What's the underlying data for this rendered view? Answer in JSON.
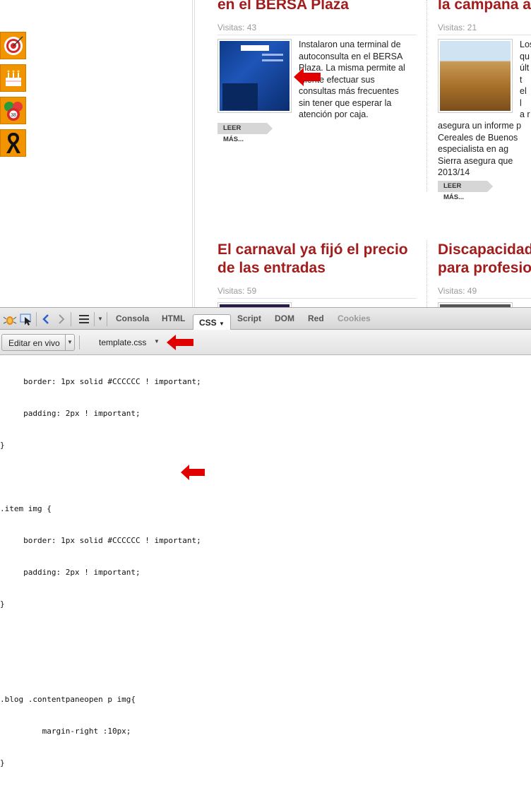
{
  "articles": [
    {
      "title_line2": "en el BERSA Plaza",
      "visits": "Visitas: 43",
      "text_lines": [
        "Instalaron una terminal de",
        "autoconsulta en el BERSA",
        "Plaza. La misma permite al",
        "cliente efectuar sus",
        "consultas más frecuentes",
        "sin tener que esperar la",
        "atención por caja."
      ],
      "read_more": "LEER MÁS..."
    },
    {
      "title_line2": "la campana a",
      "visits": "Visitas: 21",
      "text_side": [
        "Los",
        "qu",
        "últ",
        "t",
        "el",
        "l",
        "a r"
      ],
      "text_lines": [
        "asegura un informe p",
        "Cereales de Buenos",
        "especialista en ag",
        "Sierra asegura que",
        "2013/14"
      ],
      "read_more": "LEER MÁS..."
    },
    {
      "title_line1": "El carnaval ya fijó el precio",
      "title_line2": "de las entradas",
      "visits": "Visitas: 59"
    },
    {
      "title_line1": "Discapacidad",
      "title_line2": "para profesio",
      "visits": "Visitas: 49"
    }
  ],
  "left_icons": [
    "target-icon",
    "birthday-cake-icon",
    "bingo-ball-icon",
    "mourning-ribbon-icon"
  ],
  "firebug": {
    "tabs": [
      "Consola",
      "HTML",
      "CSS",
      "Script",
      "DOM",
      "Red",
      "Cookies"
    ],
    "active_tab": "CSS",
    "edit_button": "Editar en vivo",
    "file": "template.css",
    "code_lines": [
      "     border: 1px solid #CCCCCC ! important;",
      "     padding: 2px ! important;",
      "}",
      "",
      ".item img {",
      "     border: 1px solid #CCCCCC ! important;",
      "     padding: 2px ! important;",
      "}",
      "",
      "",
      ".blog .contentpaneopen p img{",
      "         margin-right :10px;",
      "}"
    ]
  },
  "colors": {
    "title_red": "#a21c1c",
    "orange_icon": "#f29400",
    "arrow_red": "#e00000"
  }
}
